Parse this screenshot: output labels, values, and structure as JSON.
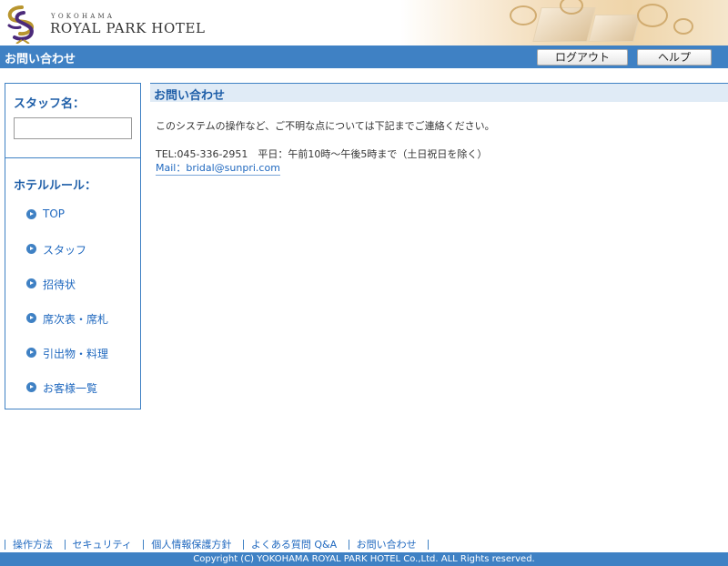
{
  "header": {
    "logo_small": "YOKOHAMA",
    "logo_main": "ROYAL PARK HOTEL",
    "title": "お問い合わせ",
    "logout_label": "ログアウト",
    "help_label": "ヘルプ"
  },
  "sidebar": {
    "staff_label": "スタッフ名：",
    "staff_value": "",
    "rules_label": "ホテルルール：",
    "items": [
      {
        "label": "TOP"
      },
      {
        "label": "スタッフ"
      },
      {
        "label": "招待状"
      },
      {
        "label": "席次表・席札"
      },
      {
        "label": "引出物・料理"
      },
      {
        "label": "お客様一覧"
      }
    ]
  },
  "main": {
    "heading": "お問い合わせ",
    "line1": "このシステムの操作など、ご不明な点については下記までご連絡ください。",
    "line2": "TEL:045-336-2951　平日：午前10時～午後5時まで（土日祝日を除く）",
    "mail": "Mail：bridal@sunpri.com"
  },
  "footer": {
    "links": [
      "操作方法",
      "セキュリティ",
      "個人情報保護方針",
      "よくある質問 Q&A",
      "お問い合わせ"
    ],
    "copyright": "Copyright (C) YOKOHAMA ROYAL PARK HOTEL Co.,Ltd. ALL Rights reserved."
  },
  "colors": {
    "accent": "#3f81c4",
    "heading_text": "#1e5ea8",
    "link": "#1f68bf",
    "heading_bg": "#e0ebf6"
  },
  "icons": {
    "nav_bullet": "circle-arrow-icon",
    "logo": "hotel-ribbon-logo-icon"
  }
}
